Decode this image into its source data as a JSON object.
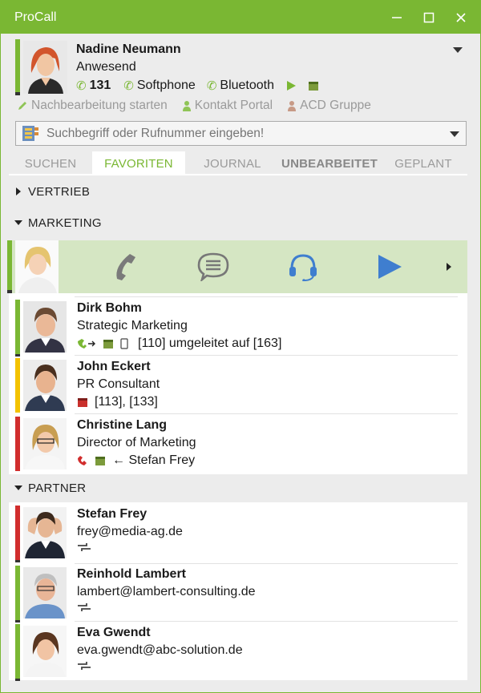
{
  "window": {
    "title": "ProCall"
  },
  "profile": {
    "name": "Nadine Neumann",
    "status": "Anwesend",
    "extension": "131",
    "device_softphone": "Softphone",
    "device_bluetooth": "Bluetooth"
  },
  "actions": {
    "post_processing": "Nachbearbeitung starten",
    "contact_portal": "Kontakt Portal",
    "acd_group": "ACD Gruppe"
  },
  "search": {
    "placeholder": "Suchbegriff oder Rufnummer eingeben!"
  },
  "tabs": [
    {
      "label": "SUCHEN"
    },
    {
      "label": "FAVORITEN"
    },
    {
      "label": "JOURNAL"
    },
    {
      "label": "UNBEARBEITET"
    },
    {
      "label": "GEPLANT"
    }
  ],
  "groups": {
    "vertrieb": "VERTRIEB",
    "marketing": "MARKETING",
    "partner": "PARTNER"
  },
  "marketing_contacts": [
    {
      "name": "Dirk Bohm",
      "role": "Strategic Marketing",
      "info": "[110] umgeleitet auf [163]",
      "status_color": "#7ab733"
    },
    {
      "name": "John Eckert",
      "role": "PR Consultant",
      "info": "[113], [133]",
      "status_color": "#f3c200"
    },
    {
      "name": "Christine Lang",
      "role": "Director of Marketing",
      "info": "← Stefan Frey",
      "status_color": "#d12d2d"
    }
  ],
  "partner_contacts": [
    {
      "name": "Stefan Frey",
      "email": "frey@media-ag.de",
      "status_color": "#d12d2d"
    },
    {
      "name": "Reinhold Lambert",
      "email": "lambert@lambert-consulting.de",
      "status_color": "#7ab733"
    },
    {
      "name": "Eva Gwendt",
      "email": "eva.gwendt@abc-solution.de",
      "status_color": "#7ab733"
    }
  ],
  "colors": {
    "accent": "#7ab733",
    "busy": "#d12d2d",
    "away": "#f3c200",
    "selected_row": "#d5e6c3"
  }
}
